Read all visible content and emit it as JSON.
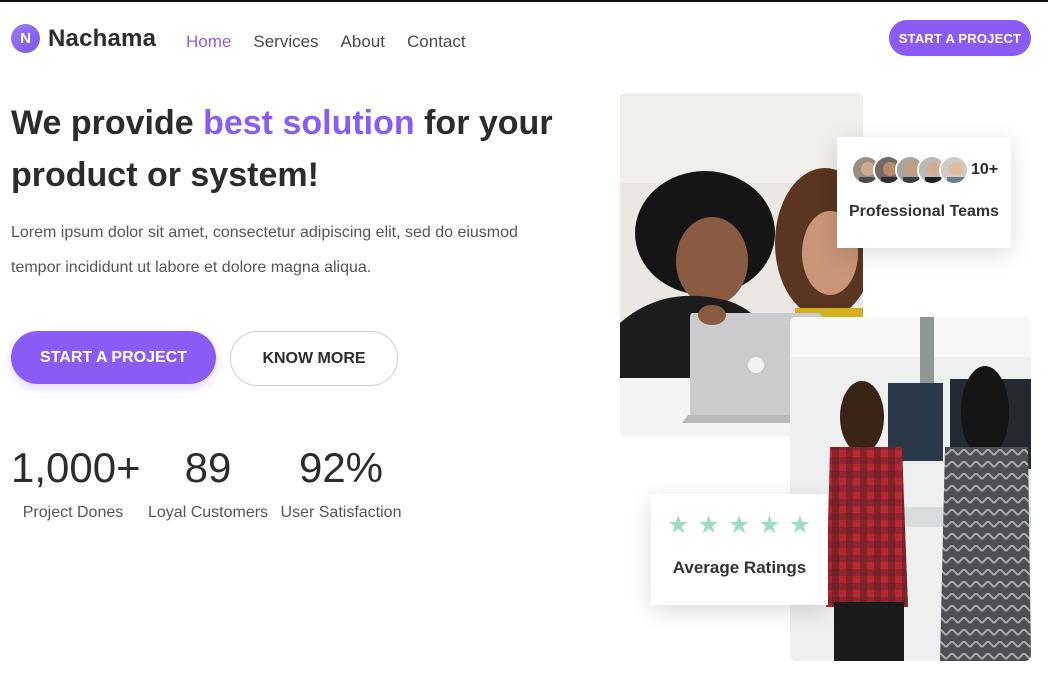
{
  "header": {
    "logo_letter": "N",
    "brand": "Nachama",
    "nav": [
      "Home",
      "Services",
      "About",
      "Contact"
    ],
    "active_nav": "Home",
    "cta_label": "START A PROJECT"
  },
  "hero": {
    "title_before": "We provide ",
    "title_accent": "best solution",
    "title_after": " for your product or system!",
    "description": "Lorem ipsum dolor sit amet, consectetur adipiscing elit, sed do eiusmod tempor incididunt ut labore et dolore magna aliqua.",
    "primary_button": "START A PROJECT",
    "secondary_button": "KNOW MORE"
  },
  "stats": [
    {
      "value": "1,000+",
      "label": "Project Dones"
    },
    {
      "value": "89",
      "label": "Loyal Customers"
    },
    {
      "value": "92%",
      "label": "User Satisfaction"
    }
  ],
  "teams_card": {
    "count": "10+",
    "label": "Professional Teams",
    "avatar_count": 5
  },
  "ratings_card": {
    "stars": 5,
    "label": "Average Ratings"
  },
  "colors": {
    "accent": "#8a5cf5",
    "star": "#9fdcc4",
    "text": "#2c2c2c"
  }
}
